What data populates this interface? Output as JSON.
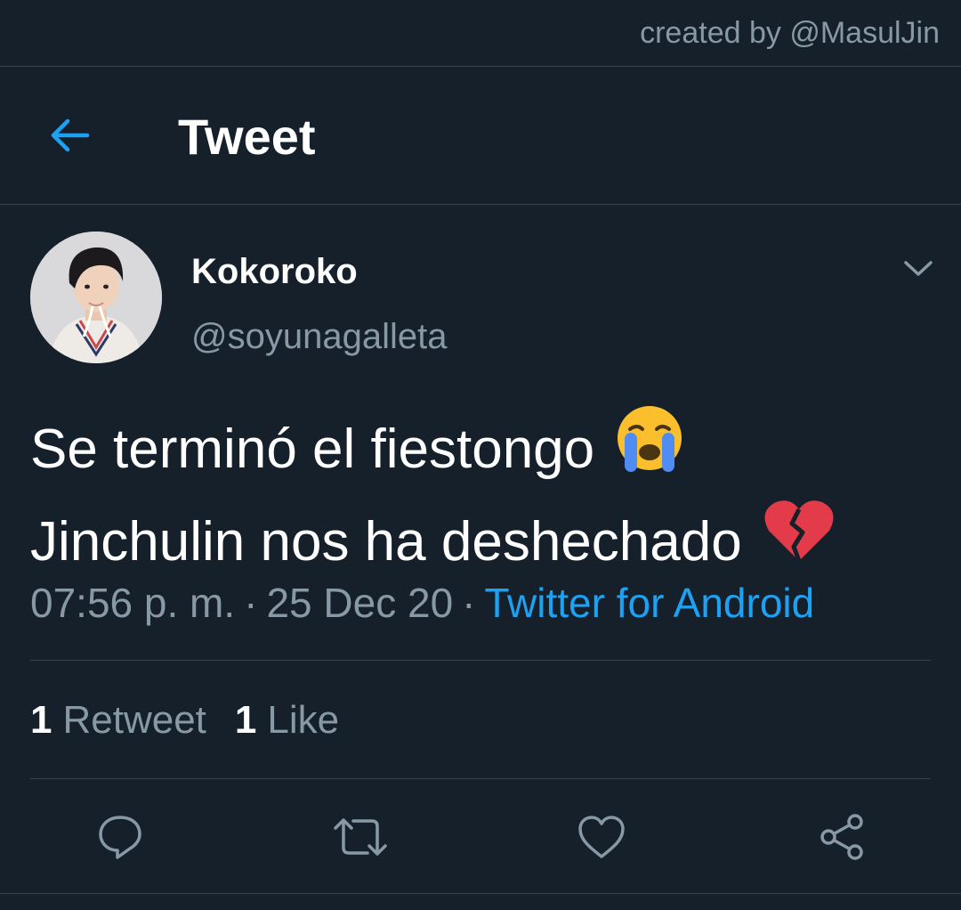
{
  "watermark": "created by @MasulJin",
  "header": {
    "title": "Tweet",
    "back_icon": "arrow-left-icon"
  },
  "author": {
    "display_name": "Kokoroko",
    "handle": "@soyunagalleta",
    "avatar": "profile-photo"
  },
  "tweet": {
    "lines": [
      {
        "text": "Se terminó el fiestongo",
        "emoji": "loudly-crying-face-emoji"
      },
      {
        "text": "Jinchulin nos ha deshechado",
        "emoji": "broken-heart-emoji"
      }
    ],
    "time": "07:56 p. m.",
    "date": "25 Dec 20",
    "source": "Twitter for Android",
    "separator": "·"
  },
  "stats": {
    "retweets_count": "1",
    "retweets_label": "Retweet",
    "likes_count": "1",
    "likes_label": "Like"
  },
  "actions": [
    "reply-icon",
    "retweet-icon",
    "like-icon",
    "share-icon"
  ],
  "colors": {
    "background": "#15202b",
    "accent": "#1da1f2",
    "muted_text": "#8899a6",
    "divider": "#38444d"
  }
}
